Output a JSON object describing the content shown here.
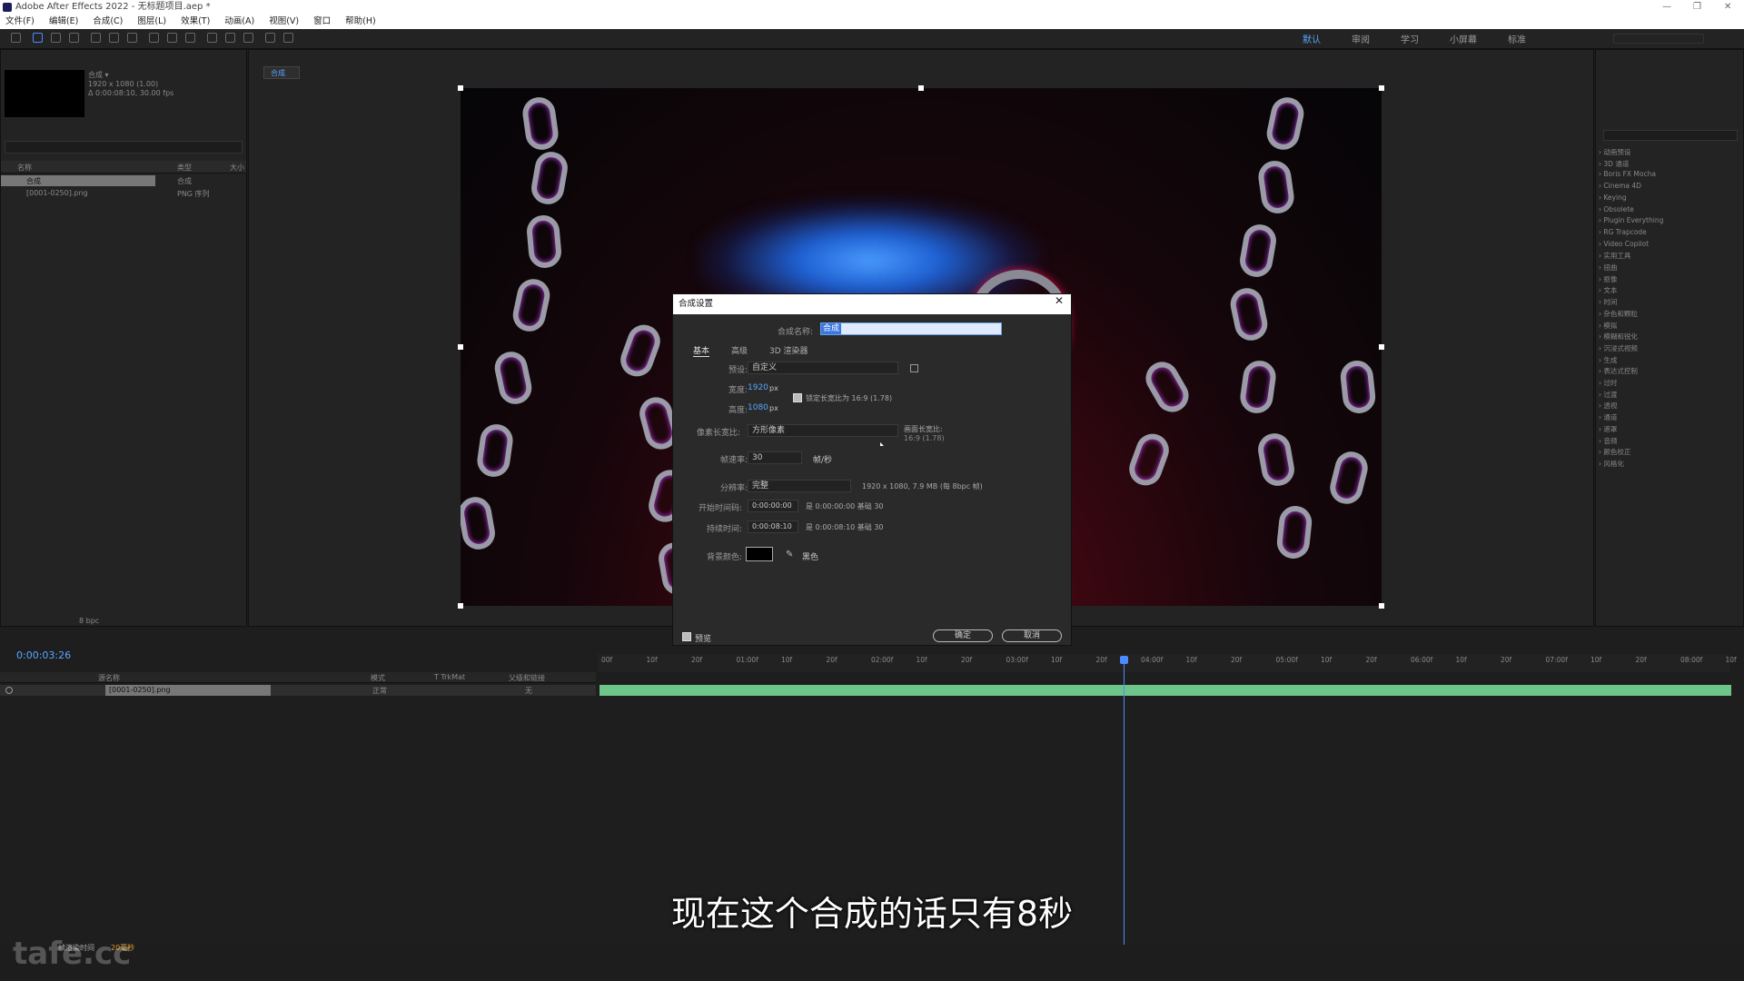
{
  "window": {
    "title": "Adobe After Effects 2022 - 无标题项目.aep *"
  },
  "menu": [
    "文件(F)",
    "编辑(E)",
    "合成(C)",
    "图层(L)",
    "效果(T)",
    "动画(A)",
    "视图(V)",
    "窗口",
    "帮助(H)"
  ],
  "workspaces": [
    "默认",
    "审阅",
    "学习",
    "小屏幕",
    "标准"
  ],
  "project": {
    "comp_name": "合成 ▾",
    "comp_info1": "1920 x 1080 (1.00)",
    "comp_info2": "Δ 0:00:08:10, 30.00 fps",
    "col_name": "名称",
    "col_type": "类型",
    "col_size": "大小",
    "items": [
      {
        "name": "合成",
        "type": "合成"
      },
      {
        "name": "[0001-0250].png",
        "type": "PNG 序列"
      }
    ],
    "bpc": "8 bpc"
  },
  "viewer": {
    "tab": "合成"
  },
  "dialog": {
    "title": "合成设置",
    "name_label": "合成名称:",
    "name_value": "合成",
    "tabs": [
      "基本",
      "高级",
      "3D 渲染器"
    ],
    "preset_label": "预设:",
    "preset_value": "自定义",
    "width_label": "宽度:",
    "width_value": "1920",
    "height_label": "高度:",
    "height_value": "1080",
    "px": "px",
    "lock_ratio": "锁定长宽比为 16:9 (1.78)",
    "par_label": "像素长宽比:",
    "par_value": "方形像素",
    "frame_aspect_label": "画面长宽比:",
    "frame_aspect_value": "16:9 (1.78)",
    "fps_label": "帧速率:",
    "fps_value": "30",
    "fps_unit": "帧/秒",
    "res_label": "分辨率:",
    "res_value": "完整",
    "res_info": "1920 x 1080, 7.9 MB (每 8bpc 帧)",
    "start_label": "开始时间码:",
    "start_value": "0:00:00:00",
    "start_info": "是 0:00:00:00 基础 30",
    "dur_label": "持续时间:",
    "dur_value": "0:00:08:10",
    "dur_info": "是 0:00:08:10 基础 30",
    "bg_label": "背景颜色:",
    "bg_name": "黑色",
    "preview_label": "预览",
    "ok": "确定",
    "cancel": "取消"
  },
  "timeline": {
    "timecode": "0:00:03:26",
    "col_source": "源名称",
    "col_mode": "模式",
    "col_trkmat": "T TrkMat",
    "col_parent": "父级和链接",
    "layer_name": "[0001-0250].png",
    "layer_mode": "正常",
    "layer_parent": "无",
    "ruler": [
      "00f",
      "10f",
      "20f",
      "01:00f",
      "10f",
      "20f",
      "02:00f",
      "10f",
      "20f",
      "03:00f",
      "10f",
      "20f",
      "04:00f",
      "10f",
      "20f",
      "05:00f",
      "10f",
      "20f",
      "06:00f",
      "10f",
      "20f",
      "07:00f",
      "10f",
      "20f",
      "08:00f",
      "10f"
    ],
    "footer": "帧渲染时间",
    "footer_ms": "20毫秒"
  },
  "effects": [
    "动画预设",
    "3D 通道",
    "Boris FX Mocha",
    "Cinema 4D",
    "Keying",
    "Obsolete",
    "Plugin Everything",
    "RG Trapcode",
    "Video Copilot",
    "实用工具",
    "扭曲",
    "抠像",
    "文本",
    "时间",
    "杂色和颗粒",
    "模拟",
    "模糊和锐化",
    "沉浸式视频",
    "生成",
    "表达式控制",
    "过时",
    "过渡",
    "透视",
    "通道",
    "遮罩",
    "音频",
    "颜色校正",
    "风格化"
  ],
  "subtitle": "现在这个合成的话只有8秒",
  "watermark": "tafe.cc"
}
